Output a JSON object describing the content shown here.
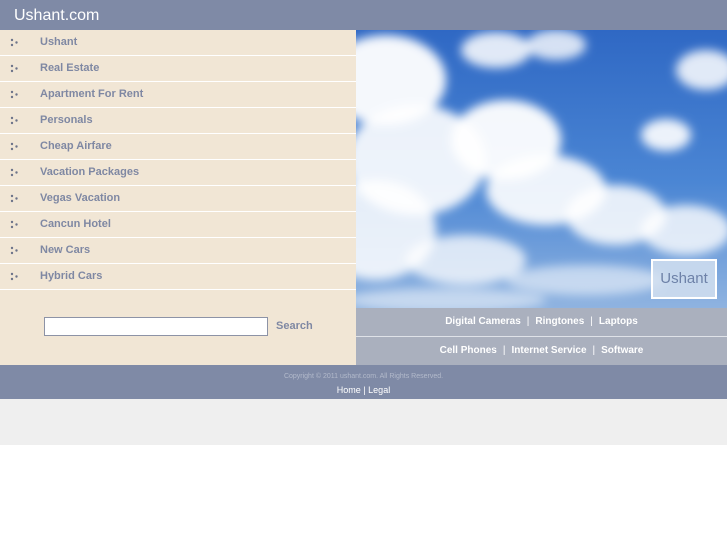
{
  "header": {
    "site_title": "Ushant.com"
  },
  "sidebar": {
    "items": [
      {
        "label": "Ushant"
      },
      {
        "label": "Real Estate"
      },
      {
        "label": "Apartment For Rent"
      },
      {
        "label": "Personals"
      },
      {
        "label": "Cheap Airfare"
      },
      {
        "label": "Vacation Packages"
      },
      {
        "label": "Vegas Vacation"
      },
      {
        "label": "Cancun Hotel"
      },
      {
        "label": "New Cars"
      },
      {
        "label": "Hybrid Cars"
      }
    ],
    "search": {
      "value": "",
      "placeholder": "",
      "button_label": "Search"
    }
  },
  "hero": {
    "badge_text": "Ushant"
  },
  "links": {
    "row1": [
      "Digital Cameras",
      "Ringtones",
      "Laptops"
    ],
    "row2": [
      "Cell Phones",
      "Internet Service",
      "Software"
    ],
    "separator": "|"
  },
  "footer": {
    "copyright": "Copyright © 2011 ushant.com. All Rights Reserved.",
    "home_label": "Home",
    "separator": "|",
    "legal_label": "Legal"
  },
  "colors": {
    "header_bg": "#7f8aa6",
    "sidebar_bg": "#f1e6d5",
    "link_text": "#7f88a3",
    "links_bar_bg": "#aab0be"
  },
  "icons": {
    "nav_bullet": "dots-bullet-icon"
  }
}
